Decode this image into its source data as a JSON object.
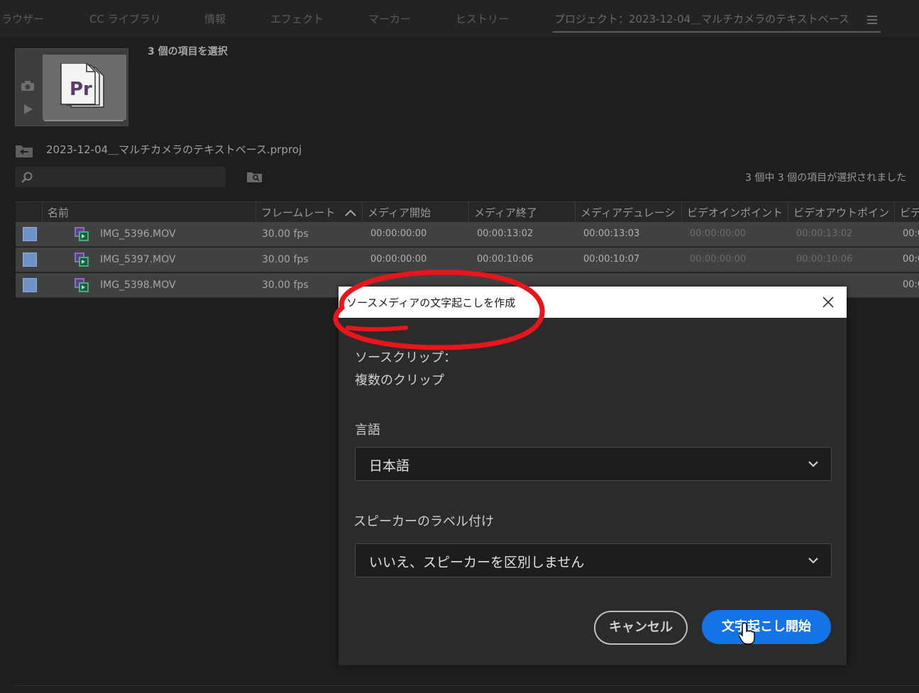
{
  "tabs": [
    {
      "label": "ラウザー"
    },
    {
      "label": "CC ライブラリ"
    },
    {
      "label": "情報"
    },
    {
      "label": "エフェクト"
    },
    {
      "label": "マーカー"
    },
    {
      "label": "ヒストリー"
    },
    {
      "label": "プロジェクト：2023-12-04＿マルチカメラのテキストベース"
    }
  ],
  "preview": {
    "selected_count": "3 個の項目を選択",
    "app_icon_text": "Pr"
  },
  "project": {
    "file_name": "2023-12-04＿マルチカメラのテキストベース.prproj",
    "status": "3 個中 3 個の項目が選択されました"
  },
  "table": {
    "columns": [
      "名前",
      "フレームレート",
      "メディア開始",
      "メディア終了",
      "メディアデュレーシ",
      "ビデオインポイント",
      "ビデオアウトポイン",
      "ビデ"
    ],
    "rows": [
      {
        "name": "IMG_5396.MOV",
        "fps": "30.00 fps",
        "start": "00:00:00:00",
        "end": "00:00:13:02",
        "duration": "00:00:13:03",
        "in": "00:00:00:00",
        "out": "00:00:13:02",
        "extra": "00:0"
      },
      {
        "name": "IMG_5397.MOV",
        "fps": "30.00 fps",
        "start": "00:00:00:00",
        "end": "00:00:10:06",
        "duration": "00:00:10:07",
        "in": "00:00:00:00",
        "out": "00:00:10:06",
        "extra": "00:0"
      },
      {
        "name": "IMG_5398.MOV",
        "fps": "30.00 fps",
        "start": "",
        "end": "",
        "duration": "",
        "in": "",
        "out": "",
        "extra": "00:0"
      }
    ]
  },
  "dialog": {
    "title": "ソースメディアの文字起こしを作成",
    "source_clip_label": "ソースクリップ：",
    "source_clip_value": "複数のクリップ",
    "language_label": "言語",
    "language_value": "日本語",
    "speaker_label": "スピーカーのラベル付け",
    "speaker_value": "いいえ、スピーカーを区別しません",
    "cancel_label": "キャンセル",
    "start_label": "文字起こし開始"
  },
  "colors": {
    "accent": "#1473e6",
    "annotation": "#e8151b",
    "checkbox": "#6f93c8"
  }
}
